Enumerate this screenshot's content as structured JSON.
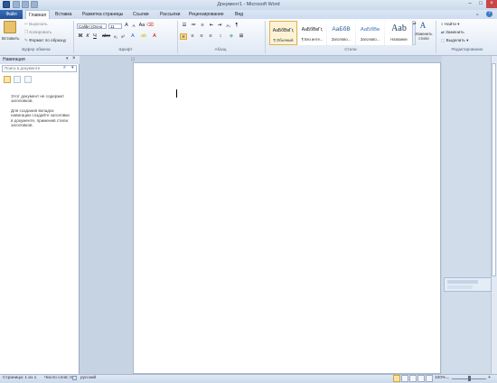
{
  "window": {
    "title": "Документ1 - Microsoft Word"
  },
  "tabs": [
    "Файл",
    "Главная",
    "Вставка",
    "Разметка страницы",
    "Ссылки",
    "Рассылки",
    "Рецензирование",
    "Вид"
  ],
  "clipboard": {
    "paste": "Вставить",
    "cut": "Вырезать",
    "copy": "Копировать",
    "format_painter": "Формат по образцу",
    "group": "Буфер обмена"
  },
  "font": {
    "name": "Calibri (Осно",
    "size": "11",
    "group": "Шрифт"
  },
  "paragraph": {
    "group": "Абзац"
  },
  "styles": {
    "group": "Стили",
    "items": [
      {
        "sample": "АаБбВвГг,",
        "name": "¶ Обычный"
      },
      {
        "sample": "АаБбВвГг,",
        "name": "¶ Без инте..."
      },
      {
        "sample": "АаБбВ",
        "name": "Заголово..."
      },
      {
        "sample": "АаБбВв",
        "name": "Заголово..."
      },
      {
        "sample": "Aab",
        "name": "Название"
      }
    ],
    "change": "Изменить стили"
  },
  "editing": {
    "find": "Найти",
    "replace": "Заменить",
    "select": "Выделить",
    "group": "Редактирование"
  },
  "nav": {
    "title": "Навигация",
    "search_placeholder": "Поиск в документе",
    "msg1": "Этот документ не содержит заголовков.",
    "msg2": "Для создания вкладок навигации создайте заголовки в документе, применив стили заголовков."
  },
  "status": {
    "page": "Страница: 1 из 1",
    "words": "Число слов: 0",
    "lang": "русский",
    "zoom": "100%"
  },
  "colors": {
    "accent": "#2b579a",
    "file_tab": "#1f4f98"
  },
  "icons": [
    "save-icon",
    "undo-icon",
    "redo-icon",
    "paste-icon",
    "scissors-icon",
    "copy-icon",
    "brush-icon",
    "search-icon",
    "close-icon",
    "find-icon",
    "replace-icon",
    "select-icon"
  ]
}
